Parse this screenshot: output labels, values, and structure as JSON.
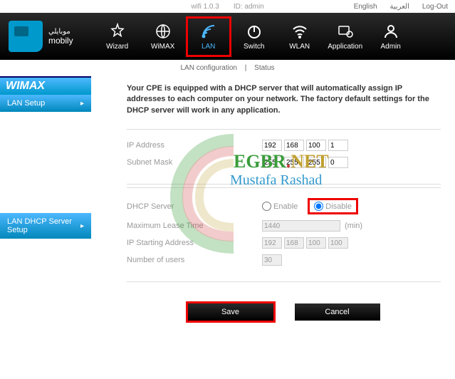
{
  "topbar": {
    "version": "wifi 1.0.3",
    "id_label": "ID: admin",
    "english": "English",
    "arabic": "العربية",
    "logout": "Log-Out"
  },
  "logo": {
    "brand": "mobily",
    "arabic": "موبايلي"
  },
  "nav": {
    "wizard": "Wizard",
    "wimax": "WiMAX",
    "lan": "LAN",
    "switch": "Switch",
    "wlan": "WLAN",
    "application": "Application",
    "admin": "Admin"
  },
  "subnav": {
    "lan_config": "LAN configuration",
    "status": "Status",
    "sep": "|"
  },
  "sidebar": {
    "header": "WIMAX",
    "lan_setup": "LAN Setup",
    "dhcp_setup": "LAN DHCP Server Setup"
  },
  "main": {
    "intro": "Your CPE is equipped with a DHCP server that will automatically assign IP addresses to each computer on your network. The factory default settings for the DHCP server will work in any application.",
    "ip_label": "IP Address",
    "ip": [
      "192",
      "168",
      "100",
      "1"
    ],
    "subnet_label": "Subnet Mask",
    "subnet": [
      "255",
      "255",
      "255",
      "0"
    ],
    "dhcp_label": "DHCP Server",
    "enable": "Enable",
    "disable": "Disable",
    "lease_label": "Maximum Lease Time",
    "lease_val": "1440",
    "lease_unit": "(min)",
    "start_label": "IP Starting Address",
    "start": [
      "192",
      "168",
      "100",
      "100"
    ],
    "users_label": "Number of users",
    "users_val": "30",
    "save": "Save",
    "cancel": "Cancel"
  },
  "watermark": {
    "t1a": "EGBR",
    "t1b": ".",
    "t1c": "NET",
    "t2": "Mustafa Rashad"
  }
}
